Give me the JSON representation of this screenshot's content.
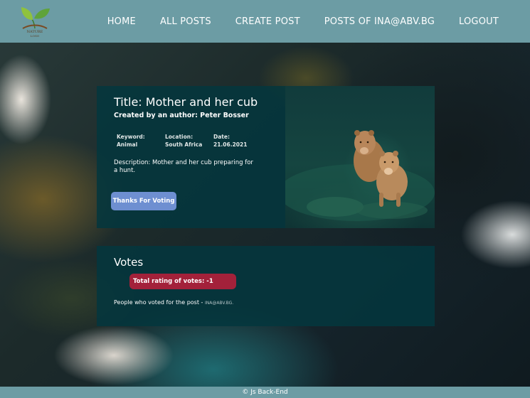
{
  "nav": {
    "logo_text": "NATURE",
    "logo_sub": "LOGO",
    "links": [
      "HOME",
      "ALL POSTS",
      "CREATE POST",
      "POSTS OF INA@ABV.BG",
      "LOGOUT"
    ]
  },
  "post": {
    "title": "Title: Mother and her cub",
    "author": "Created by an author: Peter Bosser",
    "keyword": "Keyword: Animal",
    "location": "Location: South Africa",
    "date": "Date: 21.06.2021",
    "description": "Description: Mother and her cub preparing for a hunt.",
    "vote_button": "Thanks For Voting"
  },
  "votes": {
    "heading": "Votes",
    "rating": "Total rating of votes: -1",
    "voters_label": "People who voted for the post - ",
    "voter_email": "INA@ABV.BG."
  },
  "footer": {
    "text": "© Js Back-End"
  },
  "colors": {
    "navbar": "#6c9ca4",
    "card": "#03373e",
    "vote_button": "#6e8fd1",
    "rating_badge": "#a3213a"
  }
}
